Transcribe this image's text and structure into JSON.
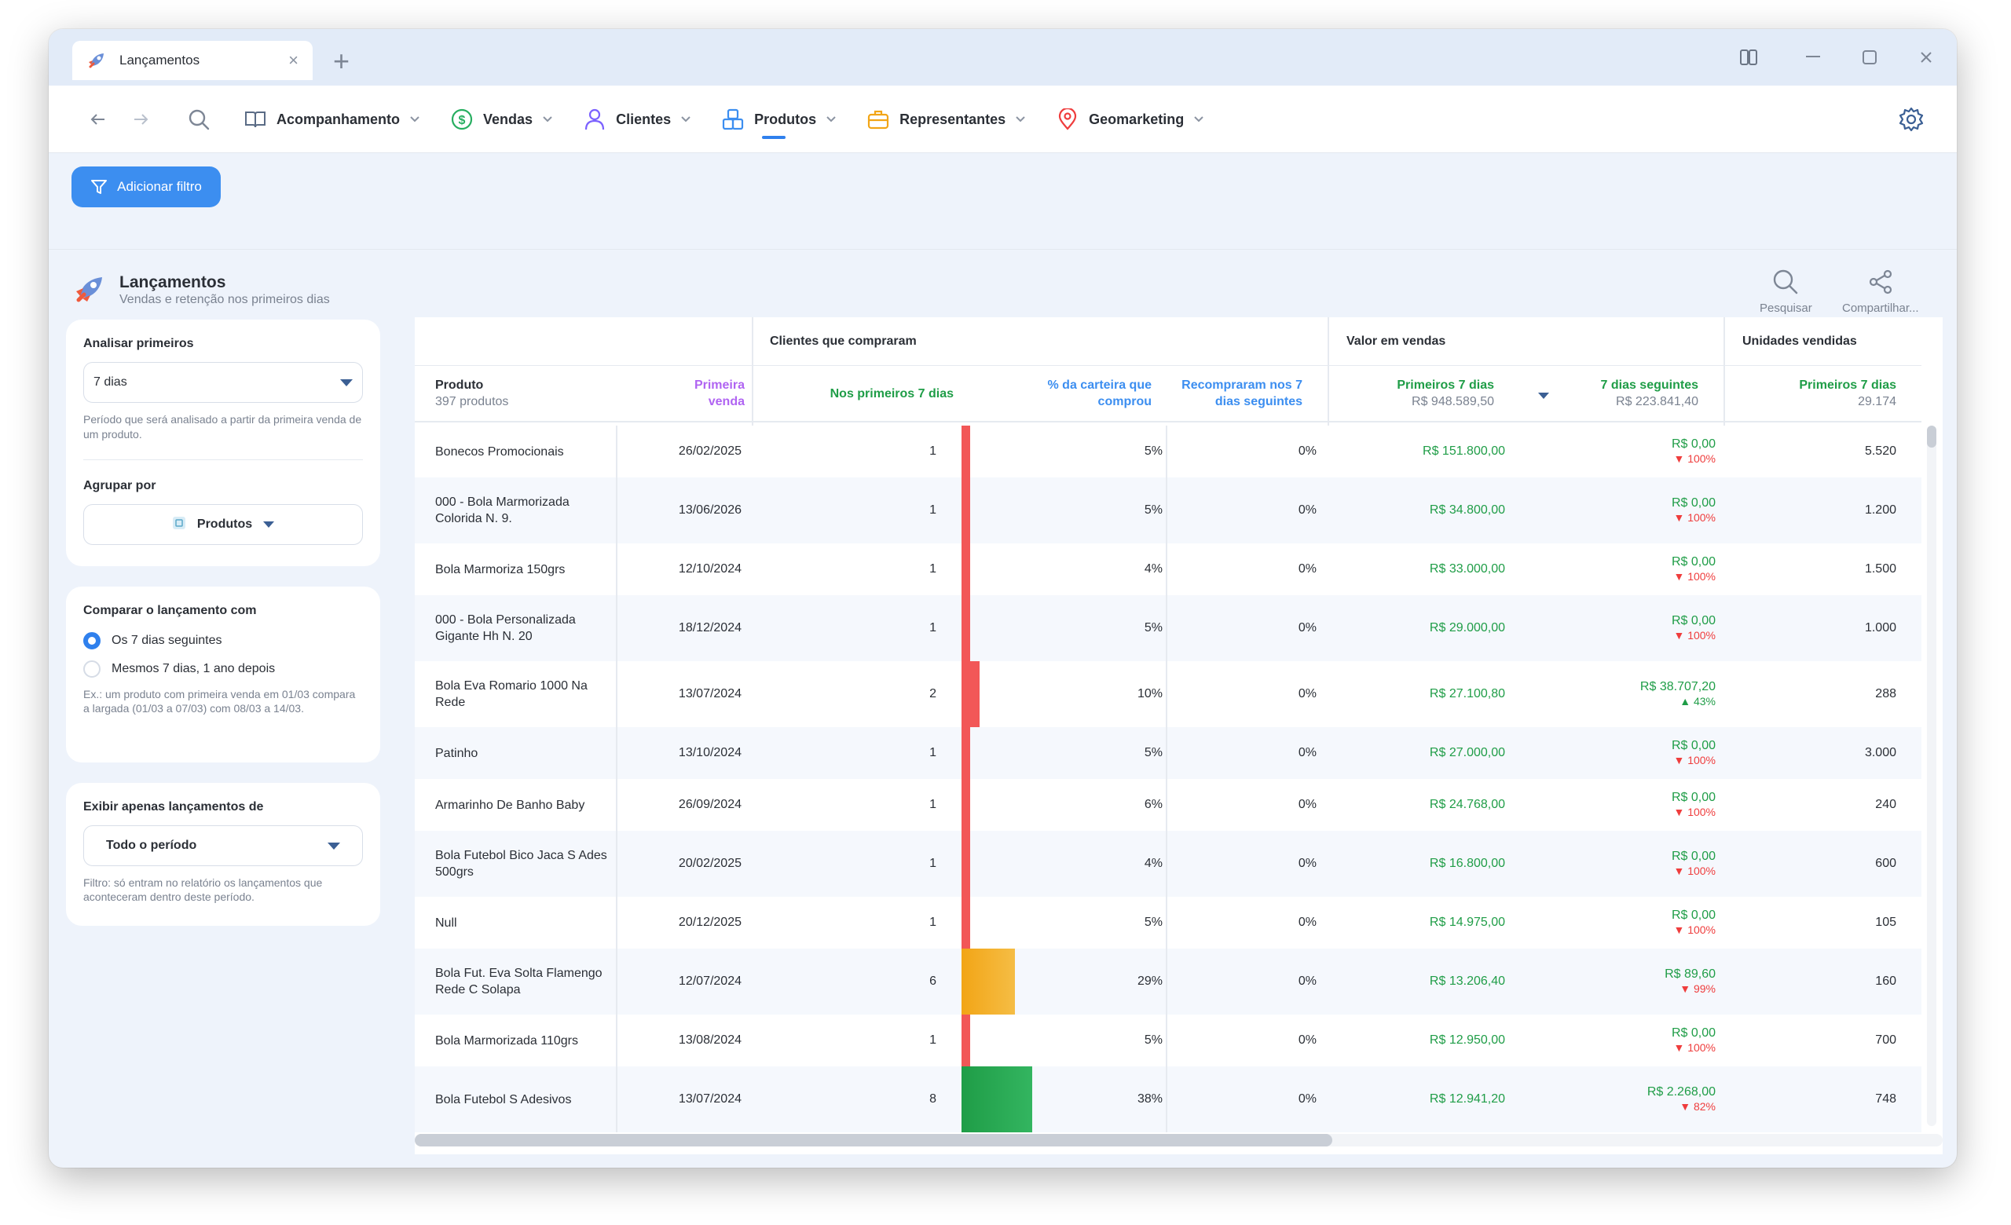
{
  "window": {
    "tab_title": "Lançamentos",
    "new_tab_symbol": "+"
  },
  "nav": {
    "menus": [
      {
        "label": "Acompanhamento",
        "icon": "book-open-icon",
        "color": "#5a6b85"
      },
      {
        "label": "Vendas",
        "icon": "dollar-circle-icon",
        "color": "#27ae60"
      },
      {
        "label": "Clientes",
        "icon": "user-icon",
        "color": "#7b61ff"
      },
      {
        "label": "Produtos",
        "icon": "boxes-icon",
        "color": "#3c8ef0",
        "active": true
      },
      {
        "label": "Representantes",
        "icon": "briefcase-icon",
        "color": "#f2a516"
      },
      {
        "label": "Geomarketing",
        "icon": "map-pin-icon",
        "color": "#ef3d3d"
      }
    ]
  },
  "filter": {
    "add_label": "Adicionar filtro"
  },
  "header": {
    "title": "Lançamentos",
    "subtitle": "Vendas e retenção nos primeiros dias",
    "search_label": "Pesquisar",
    "share_label": "Compartilhar..."
  },
  "sidebar": {
    "analyze_label": "Analisar primeiros",
    "analyze_value": "7 dias",
    "analyze_help": "Período que será analisado a partir da primeira venda de um produto.",
    "group_label": "Agrupar por",
    "group_value": "Produtos",
    "compare_label": "Comparar o lançamento com",
    "compare_opt1": "Os 7 dias seguintes",
    "compare_opt2": "Mesmos 7 dias, 1 ano depois",
    "compare_help": "Ex.: um produto com primeira venda em 01/03 compara a largada (01/03 a 07/03) com 08/03 a 14/03.",
    "show_label": "Exibir apenas lançamentos de",
    "show_value": "Todo o período",
    "show_help": "Filtro: só entram no relatório os lançamentos que aconteceram dentro deste período."
  },
  "table": {
    "group_clients": "Clientes que compraram",
    "group_value": "Valor em vendas",
    "group_units": "Unidades vendidas",
    "col_product": "Produto",
    "col_product_sub": "397 produtos",
    "col_first_sale_1": "Primeira",
    "col_first_sale_2": "venda",
    "col_first7": "Nos primeiros 7 dias",
    "col_pct_1": "% da carteira que",
    "col_pct_2": "comprou",
    "col_rebuy_1": "Recompraram nos 7",
    "col_rebuy_2": "dias seguintes",
    "col_val_first": "Primeiros 7 dias",
    "col_val_first_total": "R$ 948.589,50",
    "col_val_next": "7 dias seguintes",
    "col_val_next_total": "R$ 223.841,40",
    "col_units_first": "Primeiros 7 dias",
    "col_units_total": "29.174",
    "rows": [
      {
        "product": "Bonecos Promocionais",
        "date": "26/02/2025",
        "clients": "1",
        "bar": 1,
        "pct": "5%",
        "rebuy": "0%",
        "v1": "R$ 151.800,00",
        "v2": "R$ 0,00",
        "chg": "100%",
        "up": false,
        "units": "5.520"
      },
      {
        "product": "000 - Bola Marmorizada Colorida N. 9.",
        "date": "13/06/2026",
        "clients": "1",
        "bar": 1,
        "pct": "5%",
        "rebuy": "0%",
        "v1": "R$ 34.800,00",
        "v2": "R$ 0,00",
        "chg": "100%",
        "up": false,
        "units": "1.200"
      },
      {
        "product": "Bola Marmoriza 150grs",
        "date": "12/10/2024",
        "clients": "1",
        "bar": 1,
        "pct": "4%",
        "rebuy": "0%",
        "v1": "R$ 33.000,00",
        "v2": "R$ 0,00",
        "chg": "100%",
        "up": false,
        "units": "1.500"
      },
      {
        "product": "000 - Bola Personalizada Gigante Hh N. 20",
        "date": "18/12/2024",
        "clients": "1",
        "bar": 1,
        "pct": "5%",
        "rebuy": "0%",
        "v1": "R$ 29.000,00",
        "v2": "R$ 0,00",
        "chg": "100%",
        "up": false,
        "units": "1.000"
      },
      {
        "product": "Bola Eva Romario 1000 Na Rede",
        "date": "13/07/2024",
        "clients": "2",
        "bar": 2,
        "pct": "10%",
        "rebuy": "0%",
        "v1": "R$ 27.100,80",
        "v2": "R$ 38.707,20",
        "chg": "43%",
        "up": true,
        "units": "288"
      },
      {
        "product": "Patinho",
        "date": "13/10/2024",
        "clients": "1",
        "bar": 1,
        "pct": "5%",
        "rebuy": "0%",
        "v1": "R$ 27.000,00",
        "v2": "R$ 0,00",
        "chg": "100%",
        "up": false,
        "units": "3.000"
      },
      {
        "product": "Armarinho De Banho Baby",
        "date": "26/09/2024",
        "clients": "1",
        "bar": 1,
        "pct": "6%",
        "rebuy": "0%",
        "v1": "R$ 24.768,00",
        "v2": "R$ 0,00",
        "chg": "100%",
        "up": false,
        "units": "240"
      },
      {
        "product": "Bola Futebol Bico Jaca S Ades 500grs",
        "date": "20/02/2025",
        "clients": "1",
        "bar": 1,
        "pct": "4%",
        "rebuy": "0%",
        "v1": "R$ 16.800,00",
        "v2": "R$ 0,00",
        "chg": "100%",
        "up": false,
        "units": "600"
      },
      {
        "product": "Null",
        "date": "20/12/2025",
        "clients": "1",
        "bar": 1,
        "pct": "5%",
        "rebuy": "0%",
        "v1": "R$ 14.975,00",
        "v2": "R$ 0,00",
        "chg": "100%",
        "up": false,
        "units": "105"
      },
      {
        "product": "Bola Fut. Eva Solta Flamengo Rede C  Solapa",
        "date": "12/07/2024",
        "clients": "6",
        "bar": 6,
        "pct": "29%",
        "rebuy": "0%",
        "v1": "R$ 13.206,40",
        "v2": "R$ 89,60",
        "chg": "99%",
        "up": false,
        "units": "160"
      },
      {
        "product": "Bola Marmorizada 110grs",
        "date": "13/08/2024",
        "clients": "1",
        "bar": 1,
        "pct": "5%",
        "rebuy": "0%",
        "v1": "R$ 12.950,00",
        "v2": "R$ 0,00",
        "chg": "100%",
        "up": false,
        "units": "700"
      },
      {
        "product": "Bola Futebol S  Adesivos",
        "date": "13/07/2024",
        "clients": "8",
        "bar": 8,
        "pct": "38%",
        "rebuy": "0%",
        "v1": "R$ 12.941,20",
        "v2": "R$ 2.268,00",
        "chg": "82%",
        "up": false,
        "units": "748"
      }
    ]
  },
  "colors": {
    "accent": "#3c8ef0",
    "green": "#1f9d47",
    "red": "#ef3d3d",
    "bar_low": "#f25757",
    "bar_mid": "#f2a516",
    "bar_high": "#27a652"
  }
}
